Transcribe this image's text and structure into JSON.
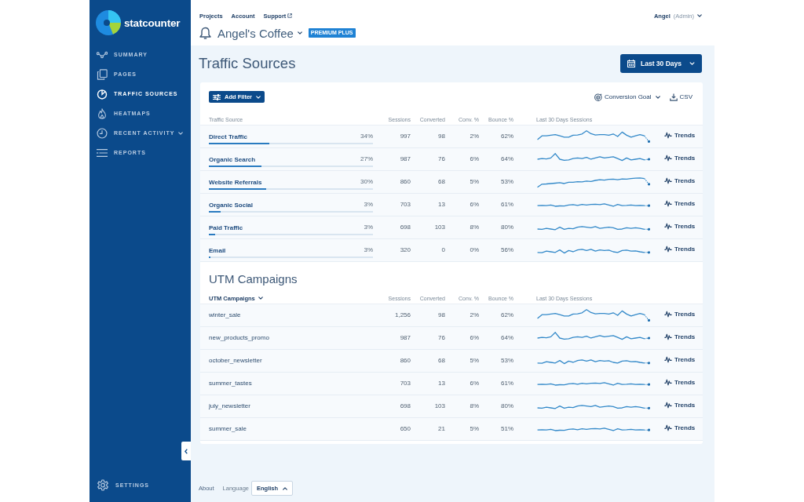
{
  "sidebar": {
    "logo": "statcounter",
    "items": [
      {
        "label": "SUMMARY",
        "selected": false,
        "has_submenu": false
      },
      {
        "label": "PAGES",
        "selected": false,
        "has_submenu": false
      },
      {
        "label": "TRAFFIC SOURCES",
        "selected": true,
        "has_submenu": false
      },
      {
        "label": "HEATMAPS",
        "selected": false,
        "has_submenu": false
      },
      {
        "label": "RECENT ACTIVITY",
        "selected": false,
        "has_submenu": true
      },
      {
        "label": "REPORTS",
        "selected": false,
        "has_submenu": false
      }
    ],
    "settings": "SETTINGS"
  },
  "header": {
    "links": [
      {
        "label": "Projects",
        "external": false
      },
      {
        "label": "Account",
        "external": false
      },
      {
        "label": "Support",
        "external": true
      }
    ],
    "user_menu": "**Angel** (Admin)",
    "project": "Angel's Coffee",
    "plan_badge": "PREMIUM PLUS"
  },
  "page": {
    "title": "Traffic Sources",
    "date_range": "Last 30 Days"
  },
  "traffic_table": {
    "toolbar": {
      "filter_button": "Add Filter",
      "goal_dropdown": "Conversion Goal",
      "export_button": "CSV"
    },
    "columns": [
      {
        "label": "Traffic Source",
        "kind": "text"
      },
      {
        "label": "Sessions",
        "kind": "text"
      },
      {
        "label": "Converted",
        "kind": "text"
      },
      {
        "label": "Conv. %",
        "kind": "text"
      },
      {
        "label": "Bounce %",
        "kind": "text"
      },
      {
        "label": "Last 30 Days Sessions",
        "kind": "text"
      }
    ],
    "rows": [
      {
        "source": "Direct Traffic",
        "share": "34%",
        "level": 0.37,
        "sessions": "997",
        "converted": "98",
        "conv_rate": "2%",
        "bounce": "62%",
        "action": "Trends"
      },
      {
        "source": "Organic Search",
        "share": "27%",
        "level": 0.32,
        "sessions": "987",
        "converted": "76",
        "conv_rate": "6%",
        "bounce": "64%",
        "action": "Trends"
      },
      {
        "source": "Website Referrals",
        "share": "30%",
        "level": 0.35,
        "sessions": "860",
        "converted": "68",
        "conv_rate": "5%",
        "bounce": "53%",
        "action": "Trends"
      },
      {
        "source": "Organic Social",
        "share": "3%",
        "level": 0.07,
        "sessions": "703",
        "converted": "13",
        "conv_rate": "6%",
        "bounce": "61%",
        "action": "Trends"
      },
      {
        "source": "Paid Traffic",
        "share": "3%",
        "level": 0.04,
        "sessions": "698",
        "converted": "103",
        "conv_rate": "8%",
        "bounce": "80%",
        "action": "Trends"
      },
      {
        "source": "Email",
        "share": "3%",
        "level": 0.01,
        "sessions": "320",
        "converted": "0",
        "conv_rate": "0%",
        "bounce": "56%",
        "action": "Trends"
      }
    ]
  },
  "utm_table": {
    "title": "UTM Campaigns",
    "columns": [
      {
        "label": "UTM Campaigns",
        "kind": "dropdown"
      },
      {
        "label": "Sessions",
        "kind": "text"
      },
      {
        "label": "Converted",
        "kind": "text"
      },
      {
        "label": "Conv. %",
        "kind": "text"
      },
      {
        "label": "Bounce %",
        "kind": "text"
      },
      {
        "label": "Last 30 Days Sessions",
        "kind": "text"
      }
    ],
    "rows": [
      {
        "campaign": "winter_sale",
        "sessions": "1,256",
        "converted": "98",
        "conv_rate": "2%",
        "bounce": "62%",
        "action": "Trends"
      },
      {
        "campaign": "new_products_promo",
        "sessions": "987",
        "converted": "76",
        "conv_rate": "6%",
        "bounce": "64%",
        "action": "Trends"
      },
      {
        "campaign": "october_newsletter",
        "sessions": "860",
        "converted": "68",
        "conv_rate": "5%",
        "bounce": "53%",
        "action": "Trends"
      },
      {
        "campaign": "summer_tastes",
        "sessions": "703",
        "converted": "13",
        "conv_rate": "6%",
        "bounce": "61%",
        "action": "Trends"
      },
      {
        "campaign": "july_newsletter",
        "sessions": "698",
        "converted": "103",
        "conv_rate": "8%",
        "bounce": "80%",
        "action": "Trends"
      },
      {
        "campaign": "summer_sale",
        "sessions": "650",
        "converted": "21",
        "conv_rate": "5%",
        "bounce": "51%",
        "action": "Trends"
      }
    ]
  },
  "footer": {
    "about": "About",
    "language_label": "Language",
    "language": "English"
  }
}
